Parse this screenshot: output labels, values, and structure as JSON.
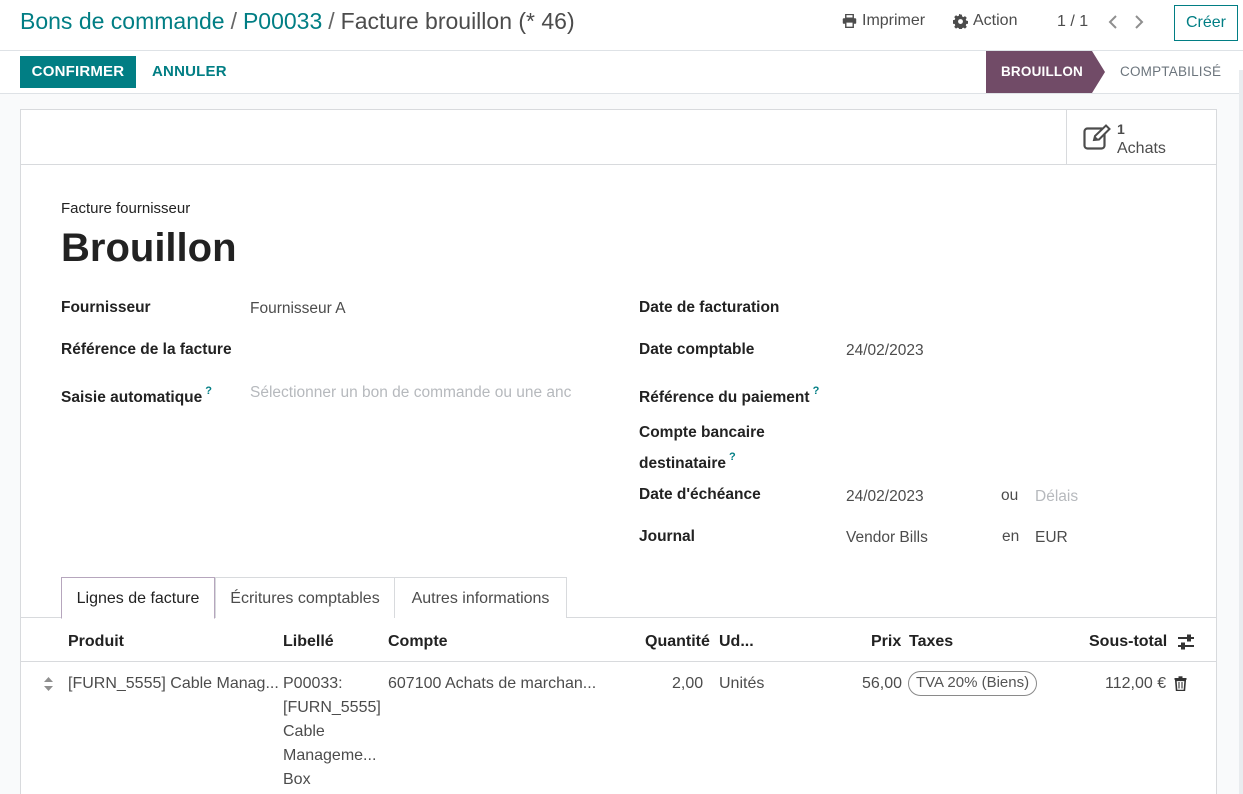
{
  "breadcrumb": {
    "items": [
      "Bons de commande",
      "P00033"
    ],
    "current": "Facture brouillon (* 46)",
    "separator": "/"
  },
  "toolbar": {
    "print_label": "Imprimer",
    "action_label": "Action",
    "pager": "1 / 1",
    "create_label": "Créer"
  },
  "statusbar": {
    "confirm_label": "CONFIRMER",
    "cancel_label": "ANNULER",
    "stages": [
      {
        "label": "BROUILLON",
        "active": true
      },
      {
        "label": "COMPTABILISÉ",
        "active": false
      }
    ],
    "active_color": "#714b67"
  },
  "smart_button": {
    "value": "1",
    "label": "Achats",
    "icon": "edit-icon"
  },
  "header": {
    "doc_type": "Facture fournisseur",
    "title": "Brouillon"
  },
  "fields_left": [
    {
      "label": "Fournisseur",
      "value": "Fournisseur A",
      "help": false
    },
    {
      "label": "Référence de la facture",
      "value": "",
      "help": false
    },
    {
      "label": "Saisie automatique",
      "value": "",
      "placeholder": "Sélectionner un bon de commande ou une anc",
      "help": true
    }
  ],
  "fields_right": {
    "invoice_date": {
      "label": "Date de facturation",
      "value": ""
    },
    "accounting_date": {
      "label": "Date comptable",
      "value": "24/02/2023"
    },
    "payment_ref": {
      "label": "Référence du paiement",
      "value": "",
      "help": true
    },
    "bank_account": {
      "label_line1": "Compte bancaire",
      "label_line2": "destinataire",
      "value": "",
      "help": true
    },
    "due_date": {
      "label": "Date d'échéance",
      "value": "24/02/2023",
      "or": "ou",
      "terms_placeholder": "Délais"
    },
    "journal": {
      "label": "Journal",
      "value": "Vendor Bills",
      "in": "en",
      "currency": "EUR"
    }
  },
  "tabs": [
    {
      "label": "Lignes de facture",
      "active": true
    },
    {
      "label": "Écritures comptables",
      "active": false
    },
    {
      "label": "Autres informations",
      "active": false
    }
  ],
  "table": {
    "headers": {
      "product": "Produit",
      "label": "Libellé",
      "account": "Compte",
      "quantity": "Quantité",
      "uom": "Ud...",
      "price": "Prix",
      "taxes": "Taxes",
      "subtotal": "Sous-total"
    },
    "rows": [
      {
        "product": "[FURN_5555] Cable Manag...",
        "label_lines": [
          "P00033:",
          "[FURN_5555]",
          "Cable",
          "Manageme...",
          "Box"
        ],
        "account": "607100 Achats de marchan...",
        "quantity": "2,00",
        "uom": "Unités",
        "price": "56,00",
        "tax": "TVA 20% (Biens)",
        "subtotal": "112,00 €"
      }
    ]
  },
  "colors": {
    "primary": "#017e84",
    "stage_active": "#714b67"
  }
}
